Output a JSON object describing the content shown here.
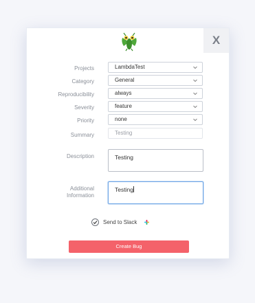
{
  "dialog": {
    "close_label": "X",
    "logo_icon": "mantis-logo-icon"
  },
  "fields": {
    "projects": {
      "label": "Projects",
      "value": "LambdaTest"
    },
    "category": {
      "label": "Category",
      "value": "General"
    },
    "reproducibility": {
      "label": "Reproducibility",
      "value": "always"
    },
    "severity": {
      "label": "Severity",
      "value": "feature"
    },
    "priority": {
      "label": "Priority",
      "value": "none"
    },
    "summary": {
      "label": "Summary",
      "value": "Testing"
    },
    "description": {
      "label": "Description",
      "value": "Testing"
    },
    "additional_information": {
      "label_line1": "Additional",
      "label_line2": "Information",
      "value": "Testing"
    }
  },
  "slack": {
    "label": "Send to Slack",
    "checked": true,
    "icon": "slack-icon"
  },
  "submit": {
    "label": "Create Bug"
  },
  "colors": {
    "accent": "#f4626a",
    "focus_border": "#6fa6e6",
    "logo_green": "#4fa83b"
  }
}
